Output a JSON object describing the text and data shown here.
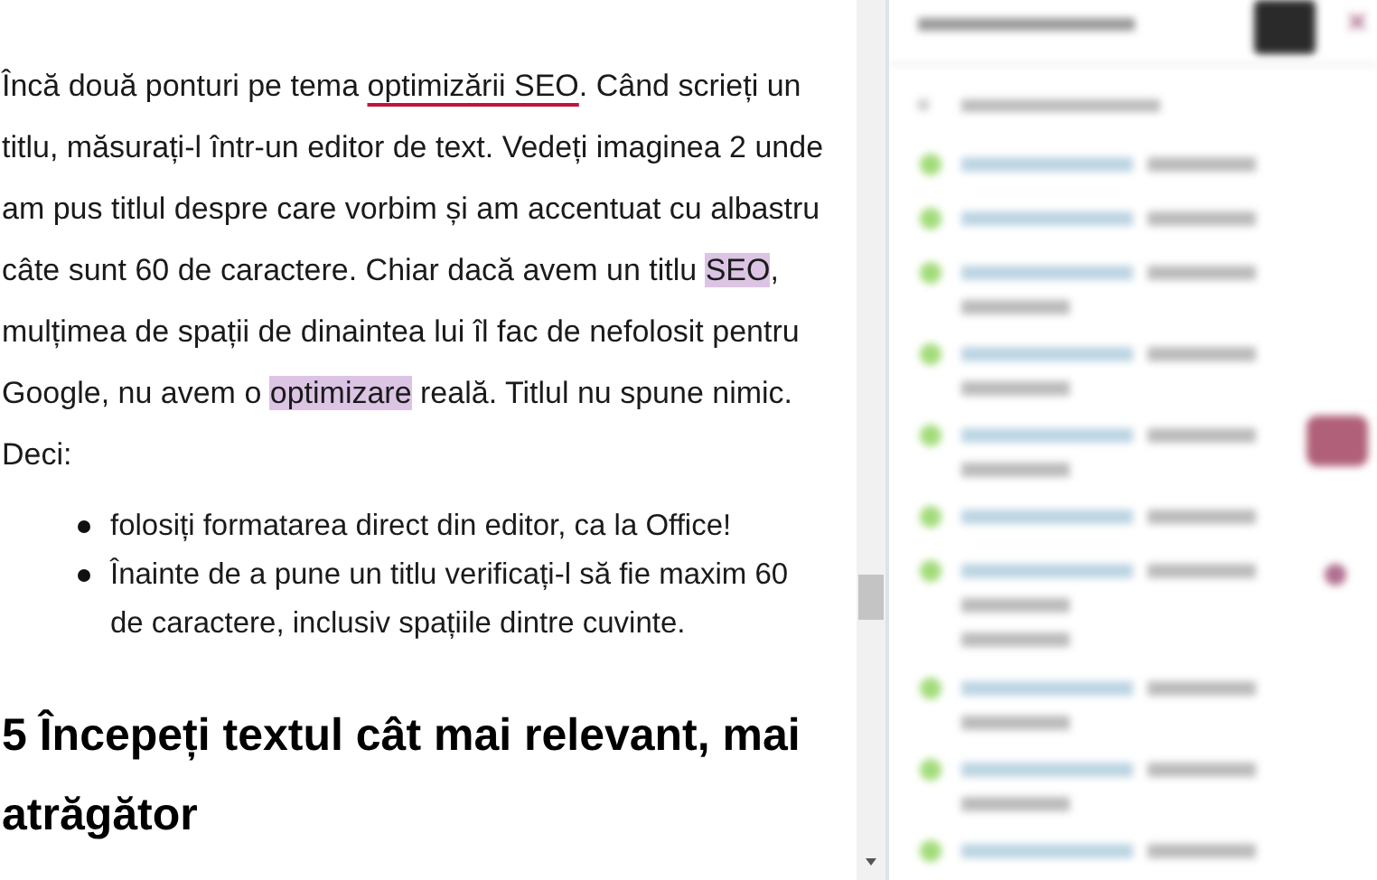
{
  "article": {
    "paragraph": [
      {
        "kind": "plain",
        "text": "Încă două ponturi pe tema "
      },
      {
        "kind": "underline",
        "text": "optimizării SEO"
      },
      {
        "kind": "plain",
        "text": ". Când scrieți un titlu, măsurați-l într-un editor de text. Vedeți imaginea 2 unde am pus titlul despre care vorbim și am accentuat cu albastru câte sunt 60 de caractere. Chiar dacă avem un titlu "
      },
      {
        "kind": "highlight",
        "text": "SEO"
      },
      {
        "kind": "plain",
        "text": ", mulțimea de spații de dinaintea lui îl fac de nefolosit pentru Google, nu avem o "
      },
      {
        "kind": "highlight",
        "text": "optimizare"
      },
      {
        "kind": "plain",
        "text": " reală. Titlul nu spune nimic. Deci:"
      }
    ],
    "bullets": [
      "folosiți formatarea direct din editor, ca la Office!",
      "Înainte de a pune un titlu verificați-l să fie maxim 60 de caractere, inclusiv spațiile dintre cuvinte."
    ],
    "heading": "5 Începeți textul cât mai relevant, mai atrăgător"
  }
}
